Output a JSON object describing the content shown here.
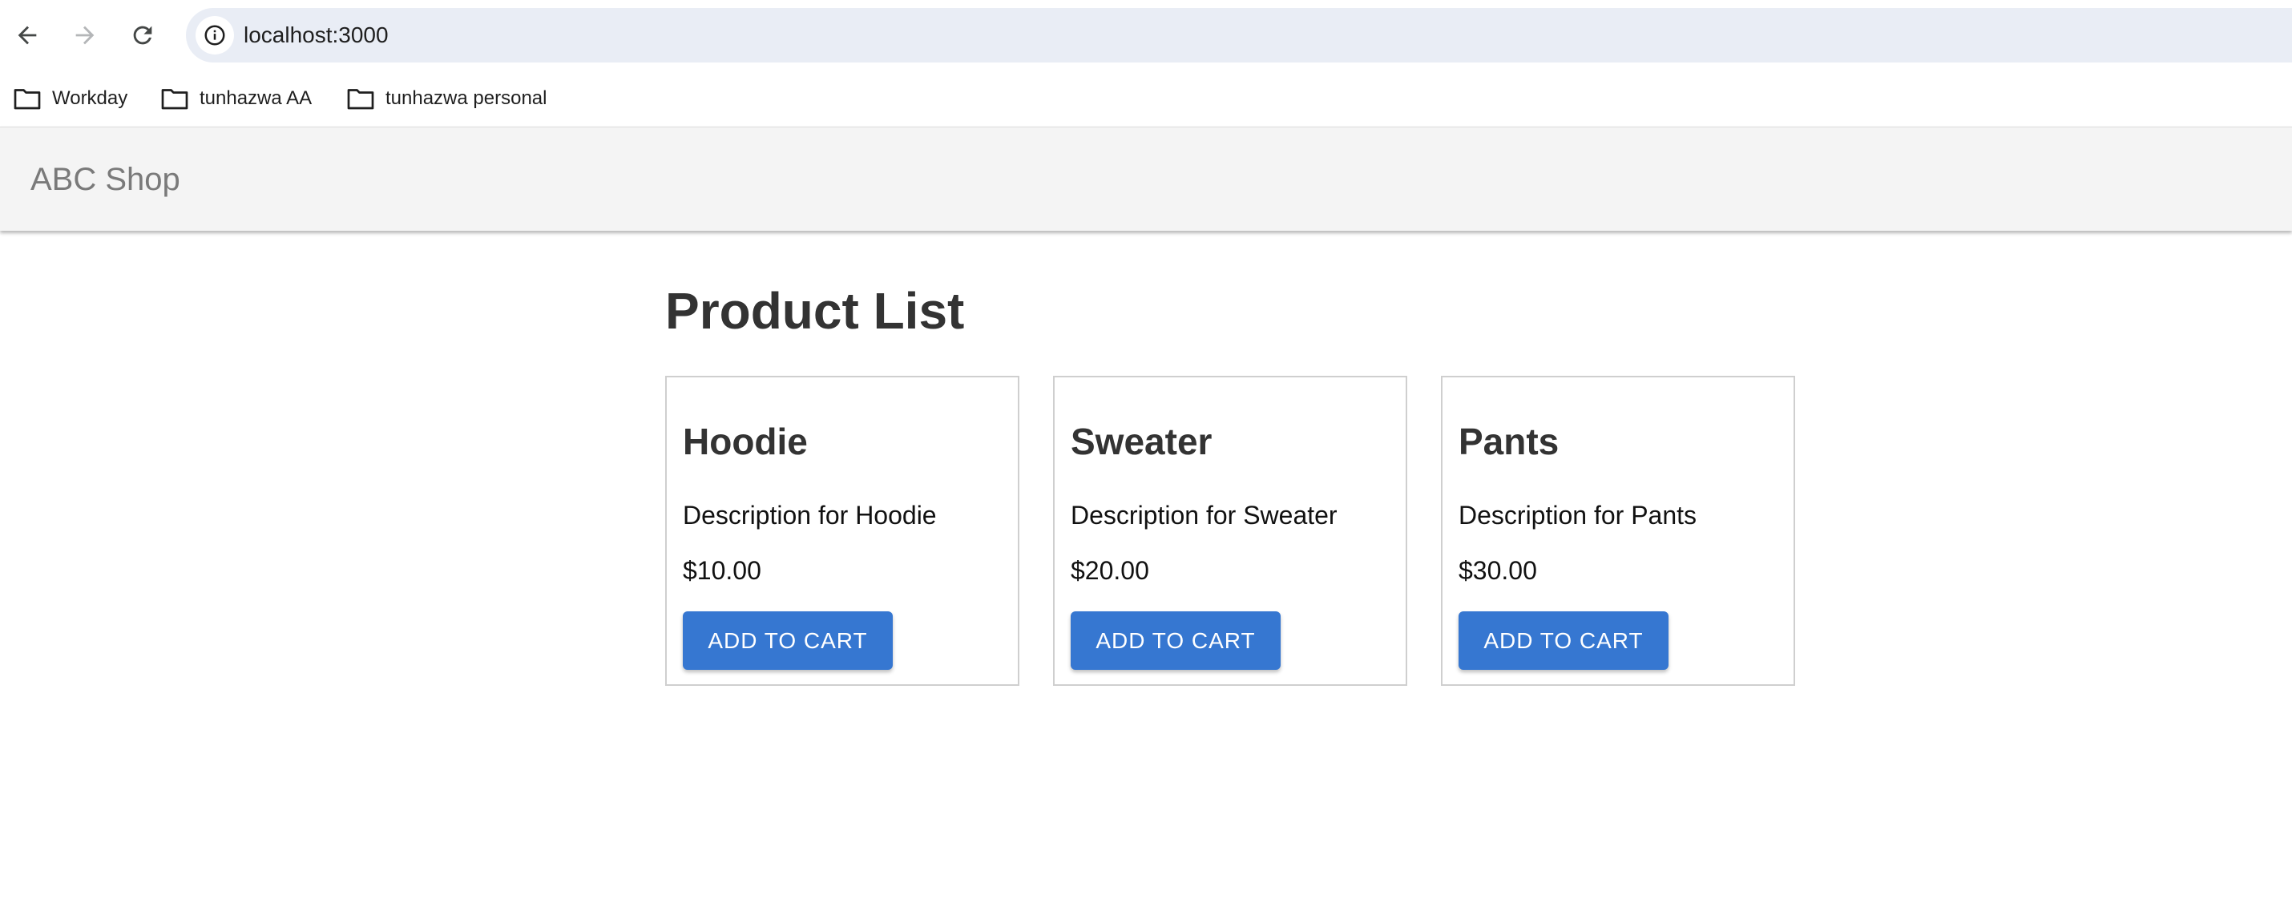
{
  "browser": {
    "url": "localhost:3000",
    "bookmarks": [
      {
        "label": "Workday"
      },
      {
        "label": "tunhazwa AA"
      },
      {
        "label": "tunhazwa personal"
      }
    ]
  },
  "app": {
    "brand": "ABC Shop",
    "page_title": "Product List",
    "products": [
      {
        "name": "Hoodie",
        "description": "Description for Hoodie",
        "price": "$10.00",
        "button_label": "ADD TO CART"
      },
      {
        "name": "Sweater",
        "description": "Description for Sweater",
        "price": "$20.00",
        "button_label": "ADD TO CART"
      },
      {
        "name": "Pants",
        "description": "Description for Pants",
        "price": "$30.00",
        "button_label": "ADD TO CART"
      }
    ]
  },
  "icons": {
    "back": "arrow-left-icon",
    "forward": "arrow-right-icon",
    "reload": "reload-icon",
    "site_info": "info-icon",
    "bookmark_folder": "folder-icon"
  },
  "colors": {
    "button_primary": "#3677d1",
    "header_background": "#f4f4f4",
    "address_bar_background": "#e9edf5",
    "brand_text": "#7a7a7a",
    "title_text": "#333333"
  }
}
